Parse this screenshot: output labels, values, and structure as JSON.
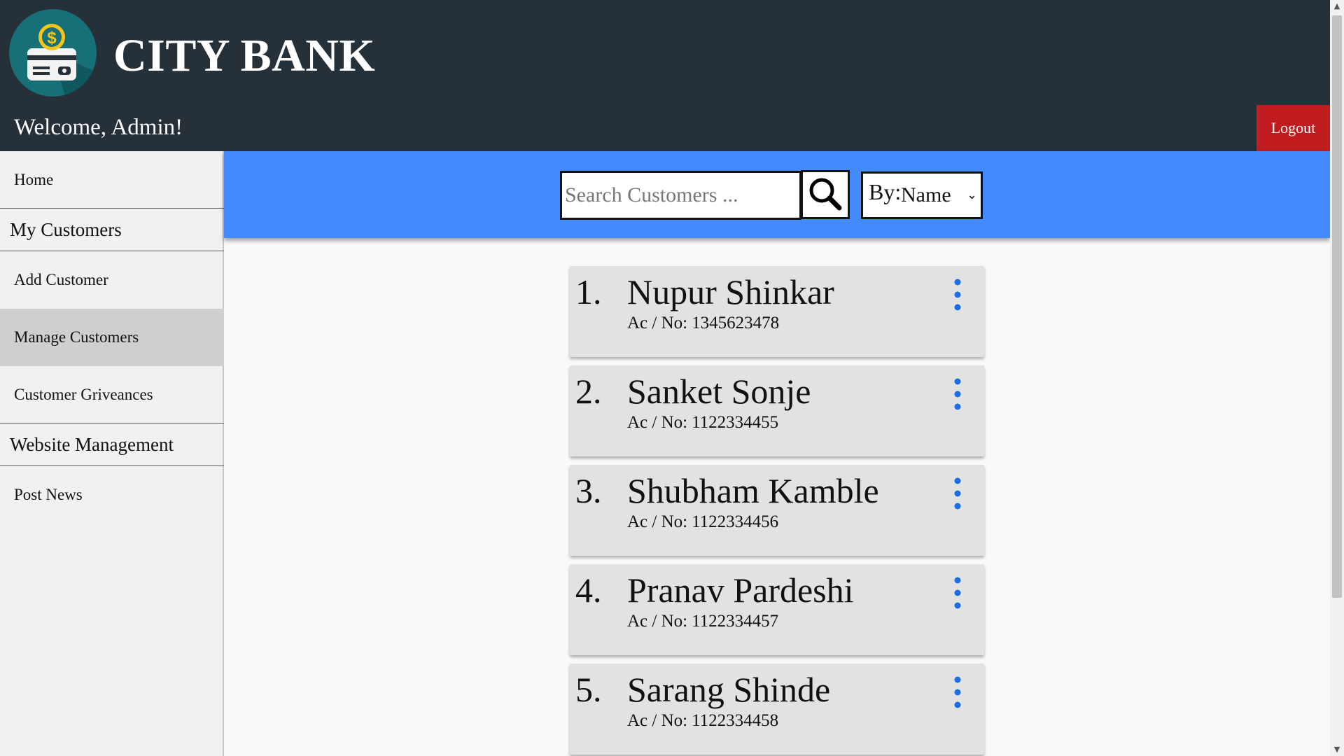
{
  "header": {
    "brand": "CITY BANK",
    "welcome": "Welcome, Admin!",
    "logout_label": "Logout",
    "logo_icon": "bank-card-dollar-icon"
  },
  "sidebar": {
    "items": [
      {
        "label": "Home",
        "kind": "link"
      },
      {
        "label": "My Customers",
        "kind": "heading"
      },
      {
        "label": "Add Customer",
        "kind": "link"
      },
      {
        "label": "Manage Customers",
        "kind": "link",
        "active": true
      },
      {
        "label": "Customer Griveances",
        "kind": "link"
      },
      {
        "label": "Website Management",
        "kind": "heading"
      },
      {
        "label": "Post News",
        "kind": "link"
      }
    ]
  },
  "search": {
    "placeholder": "Search Customers ...",
    "value": "",
    "icon": "search-icon",
    "by_label": "By:",
    "by_selected": "Name",
    "dropdown_icon": "chevron-down-icon"
  },
  "customers": {
    "account_label": "Ac / No:",
    "items": [
      {
        "index": "1.",
        "name": "Nupur Shinkar",
        "account": "1345623478"
      },
      {
        "index": "2.",
        "name": "Sanket Sonje",
        "account": "1122334455"
      },
      {
        "index": "3.",
        "name": "Shubham Kamble",
        "account": "1122334456"
      },
      {
        "index": "4.",
        "name": "Pranav Pardeshi",
        "account": "1122334457"
      },
      {
        "index": "5.",
        "name": "Sarang Shinde",
        "account": "1122334458"
      }
    ],
    "menu_icon": "more-vertical-icon"
  },
  "colors": {
    "header_bg": "#263038",
    "search_bar_bg": "#438afc",
    "logout_bg": "#c01b1f",
    "logo_bg": "#176f78",
    "logo_accent": "#f5c518",
    "menu_dots": "#1a6fe0",
    "active_nav": "#cfcfcf"
  }
}
